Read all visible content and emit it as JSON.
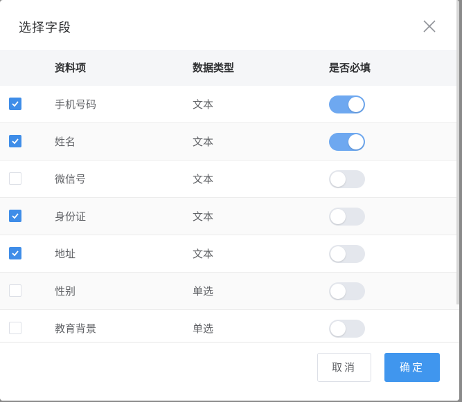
{
  "dialog": {
    "title": "选择字段",
    "close_icon": "close-icon"
  },
  "table": {
    "columns": [
      "资料项",
      "数据类型",
      "是否必填"
    ],
    "rows": [
      {
        "checked": true,
        "name": "手机号码",
        "type": "文本",
        "required": true
      },
      {
        "checked": true,
        "name": "姓名",
        "type": "文本",
        "required": true
      },
      {
        "checked": false,
        "name": "微信号",
        "type": "文本",
        "required": false
      },
      {
        "checked": true,
        "name": "身份证",
        "type": "文本",
        "required": false
      },
      {
        "checked": true,
        "name": "地址",
        "type": "文本",
        "required": false
      },
      {
        "checked": false,
        "name": "性别",
        "type": "单选",
        "required": false
      },
      {
        "checked": false,
        "name": "教育背景",
        "type": "单选",
        "required": false
      }
    ]
  },
  "footer": {
    "cancel_label": "取消",
    "confirm_label": "确定"
  },
  "colors": {
    "accent": "#4096ee",
    "switch_on": "#6ea8f0",
    "switch_off": "#e4e7ed",
    "checkbox_on": "#3f8de8"
  }
}
